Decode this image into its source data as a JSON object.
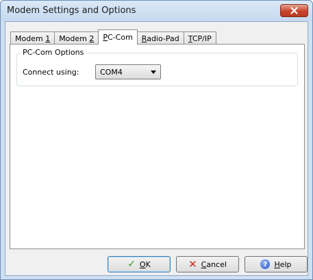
{
  "window": {
    "title": "Modem Settings and Options"
  },
  "tabs": [
    {
      "label_pre": "Modem ",
      "label_u": "1",
      "label_post": ""
    },
    {
      "label_pre": "Modem ",
      "label_u": "2",
      "label_post": ""
    },
    {
      "label_pre": "",
      "label_u": "P",
      "label_post": "C-Com"
    },
    {
      "label_pre": "",
      "label_u": "R",
      "label_post": "adio-Pad"
    },
    {
      "label_pre": "",
      "label_u": "T",
      "label_post": "CP/IP"
    }
  ],
  "active_tab": "PC-Com",
  "group": {
    "title": "PC-Com Options",
    "connect_label": "Connect using:",
    "connect_value": "COM4"
  },
  "buttons": {
    "ok": {
      "u": "O",
      "rest": "K",
      "icon": "check-icon"
    },
    "cancel": {
      "u": "C",
      "rest": "ancel",
      "icon": "x-icon"
    },
    "help": {
      "u": "H",
      "rest": "elp",
      "icon": "help-icon"
    }
  },
  "colors": {
    "close_button": "#c7442b",
    "ok_icon": "#2e9a1e",
    "cancel_icon": "#d0281b",
    "help_icon": "#2a52c8"
  }
}
